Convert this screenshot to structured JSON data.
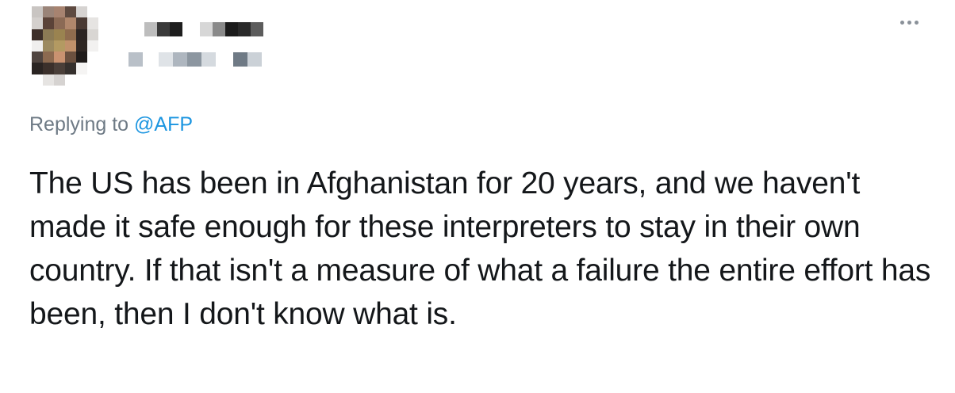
{
  "tweet": {
    "author_name": "",
    "author_handle": "",
    "reply_prefix": "Replying to",
    "reply_to_handle": "@AFP",
    "text": "The US has been in Afghanistan for 20 years, and we haven't made it safe enough for these interpreters to stay in their own country. If that isn't a measure of what a failure the entire effort has been, then I don't know what is.",
    "more_icon": "ellipsis-icon"
  },
  "colors": {
    "link": "#1b95e0",
    "secondary_text": "#6e7a85",
    "primary_text": "#14171a",
    "background": "#ffffff"
  }
}
